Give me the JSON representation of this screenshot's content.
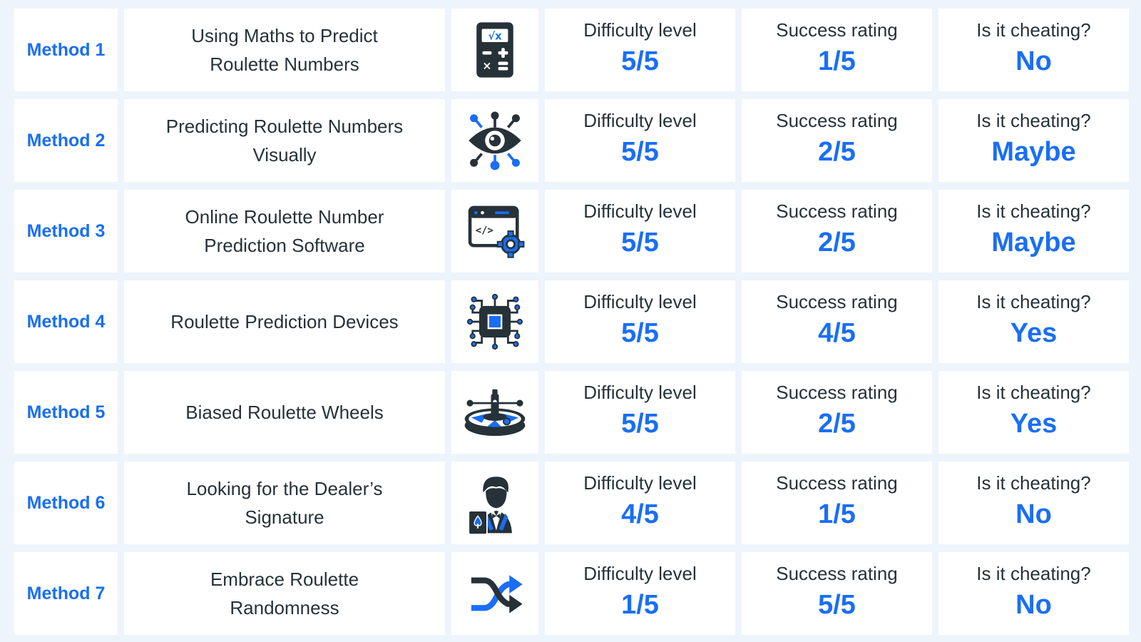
{
  "colors": {
    "accent": "#1a6ef5",
    "dark": "#263238",
    "background": "#eef4fc",
    "cell": "#ffffff"
  },
  "labels": {
    "difficulty": "Difficulty level",
    "success": "Success rating",
    "cheating": "Is it cheating?"
  },
  "rows": [
    {
      "method": "Method 1",
      "title": "Using Maths to Predict Roulette Numbers",
      "icon": "calculator-icon",
      "difficulty": "5/5",
      "success": "1/5",
      "cheating": "No"
    },
    {
      "method": "Method 2",
      "title": "Predicting Roulette Numbers Visually",
      "icon": "eye-icon",
      "difficulty": "5/5",
      "success": "2/5",
      "cheating": "Maybe"
    },
    {
      "method": "Method 3",
      "title": "Online Roulette Number Prediction Software",
      "icon": "code-window-gear-icon",
      "difficulty": "5/5",
      "success": "2/5",
      "cheating": "Maybe"
    },
    {
      "method": "Method 4",
      "title": "Roulette Prediction Devices",
      "icon": "microchip-icon",
      "difficulty": "5/5",
      "success": "4/5",
      "cheating": "Yes"
    },
    {
      "method": "Method 5",
      "title": "Biased Roulette Wheels",
      "icon": "roulette-wheel-icon",
      "difficulty": "5/5",
      "success": "2/5",
      "cheating": "Yes"
    },
    {
      "method": "Method 6",
      "title": "Looking for the Dealer’s Signature",
      "icon": "dealer-icon",
      "difficulty": "4/5",
      "success": "1/5",
      "cheating": "No"
    },
    {
      "method": "Method 7",
      "title": "Embrace Roulette Randomness",
      "icon": "shuffle-icon",
      "difficulty": "1/5",
      "success": "5/5",
      "cheating": "No"
    }
  ]
}
